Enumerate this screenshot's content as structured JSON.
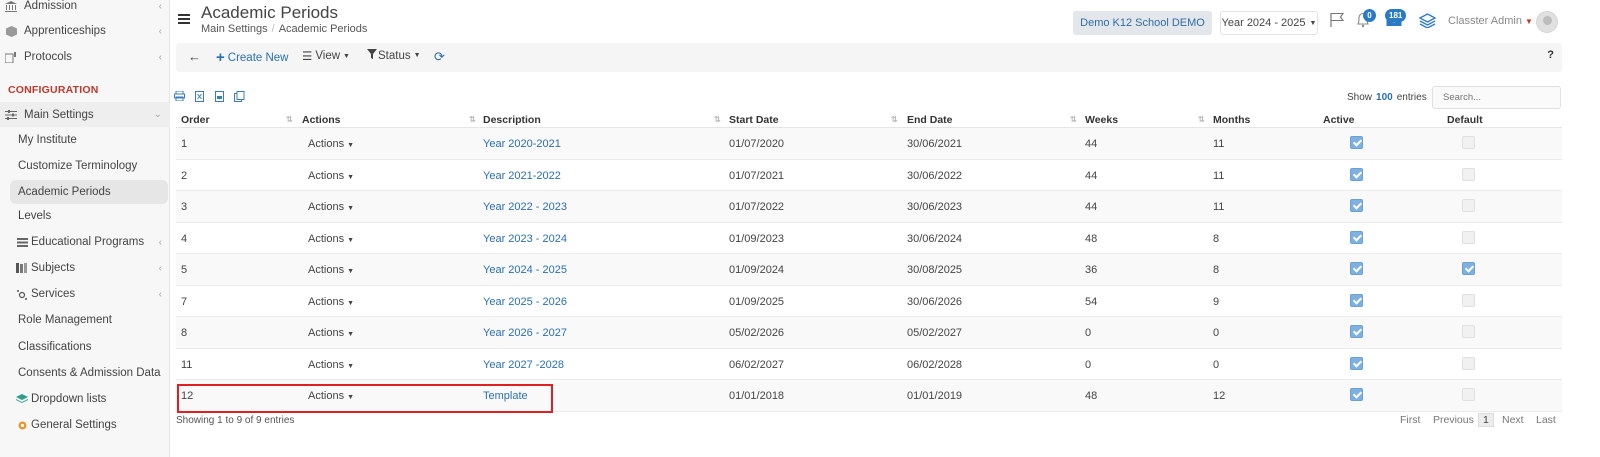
{
  "sidebar": {
    "items_top": [
      {
        "label": "Admission",
        "icon": "bank-icon"
      },
      {
        "label": "Apprenticeships",
        "icon": "box-icon"
      },
      {
        "label": "Protocols",
        "icon": "protocol-icon"
      }
    ],
    "section_label": "CONFIGURATION",
    "main_settings": {
      "label": "Main Settings",
      "icon": "sliders-icon"
    },
    "sub_items": [
      {
        "label": "My Institute"
      },
      {
        "label": "Customize Terminology"
      },
      {
        "label": "Academic Periods"
      },
      {
        "label": "Levels"
      },
      {
        "label": "Educational Programs",
        "icon": "list-icon"
      },
      {
        "label": "Subjects",
        "icon": "books-icon"
      },
      {
        "label": "Services",
        "icon": "services-icon"
      },
      {
        "label": "Role Management"
      },
      {
        "label": "Classifications"
      },
      {
        "label": "Consents & Admission Data"
      },
      {
        "label": "Dropdown lists",
        "icon": "layers-icon"
      },
      {
        "label": "General Settings",
        "icon": "gear-icon"
      }
    ]
  },
  "header": {
    "title": "Academic Periods",
    "breadcrumb": [
      "Main Settings",
      "Academic Periods"
    ],
    "school": "Demo K12 School DEMO",
    "year": "Year 2024 - 2025",
    "notifications_count": "0",
    "messages_count": "181",
    "user": "Classter Admin"
  },
  "toolbar": {
    "create_label": "Create New",
    "view_label": "View",
    "status_label": "Status",
    "help_label": "?"
  },
  "list": {
    "show_label": "Show",
    "show_count": "100",
    "entries_label": "entries",
    "search_placeholder": "Search...",
    "columns": [
      "Order",
      "Actions",
      "Description",
      "Start Date",
      "End Date",
      "Weeks",
      "Months",
      "Active",
      "Default"
    ],
    "rows": [
      {
        "order": "1",
        "actions": "Actions",
        "description": "Year 2020-2021",
        "start": "01/07/2020",
        "end": "30/06/2021",
        "weeks": "44",
        "months": "11",
        "active": true,
        "default": false
      },
      {
        "order": "2",
        "actions": "Actions",
        "description": "Year 2021-2022",
        "start": "01/07/2021",
        "end": "30/06/2022",
        "weeks": "44",
        "months": "11",
        "active": true,
        "default": false
      },
      {
        "order": "3",
        "actions": "Actions",
        "description": "Year 2022 - 2023",
        "start": "01/07/2022",
        "end": "30/06/2023",
        "weeks": "44",
        "months": "11",
        "active": true,
        "default": false
      },
      {
        "order": "4",
        "actions": "Actions",
        "description": "Year 2023 - 2024",
        "start": "01/09/2023",
        "end": "30/06/2024",
        "weeks": "48",
        "months": "8",
        "active": true,
        "default": false
      },
      {
        "order": "5",
        "actions": "Actions",
        "description": "Year 2024 - 2025",
        "start": "01/09/2024",
        "end": "30/08/2025",
        "weeks": "36",
        "months": "8",
        "active": true,
        "default": true
      },
      {
        "order": "7",
        "actions": "Actions",
        "description": "Year 2025 - 2026",
        "start": "01/09/2025",
        "end": "30/06/2026",
        "weeks": "54",
        "months": "9",
        "active": true,
        "default": false
      },
      {
        "order": "8",
        "actions": "Actions",
        "description": "Year 2026 - 2027",
        "start": "05/02/2026",
        "end": "05/02/2027",
        "weeks": "0",
        "months": "0",
        "active": true,
        "default": false
      },
      {
        "order": "11",
        "actions": "Actions",
        "description": "Year 2027 -2028",
        "start": "06/02/2027",
        "end": "06/02/2028",
        "weeks": "0",
        "months": "0",
        "active": true,
        "default": false
      },
      {
        "order": "12",
        "actions": "Actions",
        "description": "Template",
        "start": "01/01/2018",
        "end": "01/01/2019",
        "weeks": "48",
        "months": "12",
        "active": true,
        "default": false
      }
    ],
    "showing_text": "Showing 1 to 9 of 9 entries",
    "pager": {
      "first": "First",
      "previous": "Previous",
      "current": "1",
      "next": "Next",
      "last": "Last"
    }
  },
  "colors": {
    "accent": "#2b6fb6",
    "section": "#c0392b",
    "highlight": "#e02020"
  }
}
